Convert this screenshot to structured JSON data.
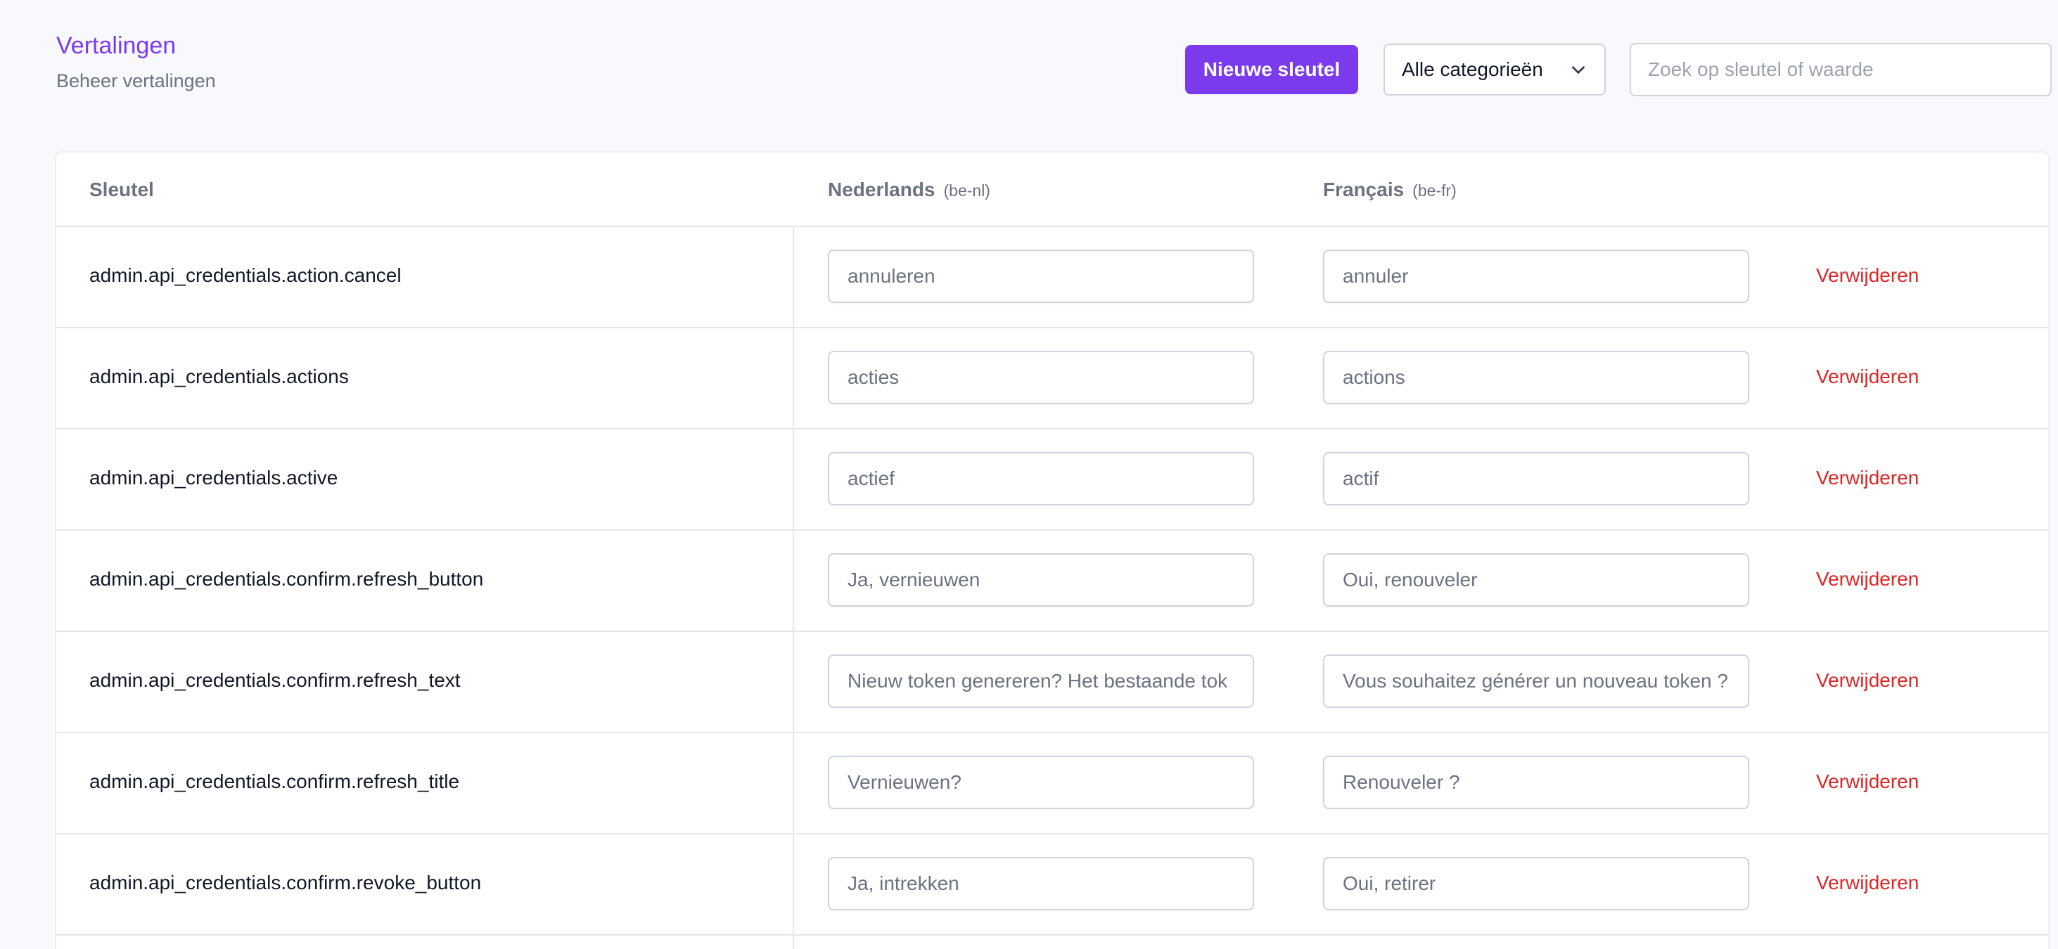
{
  "header": {
    "title": "Vertalingen",
    "subtitle": "Beheer vertalingen"
  },
  "toolbar": {
    "new_key_label": "Nieuwe sleutel",
    "category_selected": "Alle categorieën",
    "search_placeholder": "Zoek op sleutel of waarde"
  },
  "table": {
    "headers": {
      "key": "Sleutel",
      "nl": "Nederlands",
      "nl_locale": "(be-nl)",
      "fr": "Français",
      "fr_locale": "(be-fr)"
    },
    "delete_label": "Verwijderen",
    "rows": [
      {
        "key": "admin.api_credentials.action.cancel",
        "nl": "annuleren",
        "fr": "annuler"
      },
      {
        "key": "admin.api_credentials.actions",
        "nl": "acties",
        "fr": "actions"
      },
      {
        "key": "admin.api_credentials.active",
        "nl": "actief",
        "fr": "actif"
      },
      {
        "key": "admin.api_credentials.confirm.refresh_button",
        "nl": "Ja, vernieuwen",
        "fr": "Oui, renouveler"
      },
      {
        "key": "admin.api_credentials.confirm.refresh_text",
        "nl": "Nieuw token genereren? Het bestaande tok",
        "fr": "Vous souhaitez générer un nouveau token ?"
      },
      {
        "key": "admin.api_credentials.confirm.refresh_title",
        "nl": "Vernieuwen?",
        "fr": "Renouveler ?"
      },
      {
        "key": "admin.api_credentials.confirm.revoke_button",
        "nl": "Ja, intrekken",
        "fr": "Oui, retirer"
      }
    ]
  },
  "colors": {
    "accent": "#7c3aed",
    "danger": "#dc2626",
    "background": "#f8f9fc"
  }
}
